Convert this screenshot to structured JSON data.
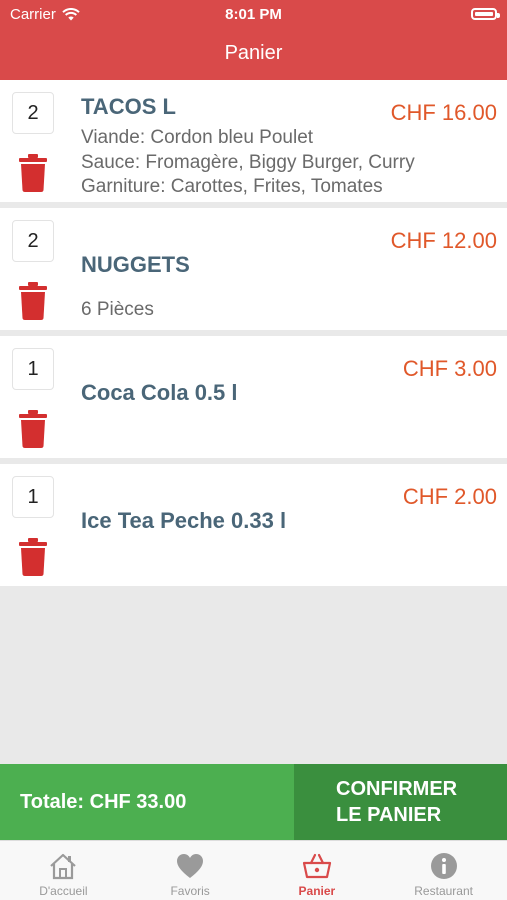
{
  "status_bar": {
    "carrier": "Carrier",
    "time": "8:01 PM"
  },
  "nav": {
    "title": "Panier"
  },
  "cart": {
    "items": [
      {
        "qty": "2",
        "name": "TACOS L",
        "price": "CHF 16.00",
        "details": [
          "Viande: Cordon bleu Poulet",
          "Sauce: Fromagère, Biggy Burger, Curry",
          "Garniture: Carottes, Frites, Tomates"
        ]
      },
      {
        "qty": "2",
        "name": "NUGGETS",
        "price": "CHF 12.00",
        "details": [
          "6 Pièces"
        ]
      },
      {
        "qty": "1",
        "name": "Coca Cola 0.5 l",
        "price": "CHF 3.00",
        "details": []
      },
      {
        "qty": "1",
        "name": "Ice Tea Peche 0.33 l",
        "price": "CHF 2.00",
        "details": []
      }
    ]
  },
  "footer": {
    "total": "Totale: CHF 33.00",
    "confirm_line1": "CONFIRMER",
    "confirm_line2": "LE PANIER"
  },
  "tabs": [
    {
      "label": "D'accueil",
      "icon": "home-icon"
    },
    {
      "label": "Favoris",
      "icon": "heart-icon"
    },
    {
      "label": "Panier",
      "icon": "basket-icon"
    },
    {
      "label": "Restaurant",
      "icon": "info-icon"
    }
  ],
  "colors": {
    "header": "#d94a4a",
    "price": "#e0582a",
    "trash": "#d32f2f",
    "total_bg": "#4caf50",
    "confirm_bg": "#3a8f3e",
    "active_tab": "#d94a4a"
  }
}
